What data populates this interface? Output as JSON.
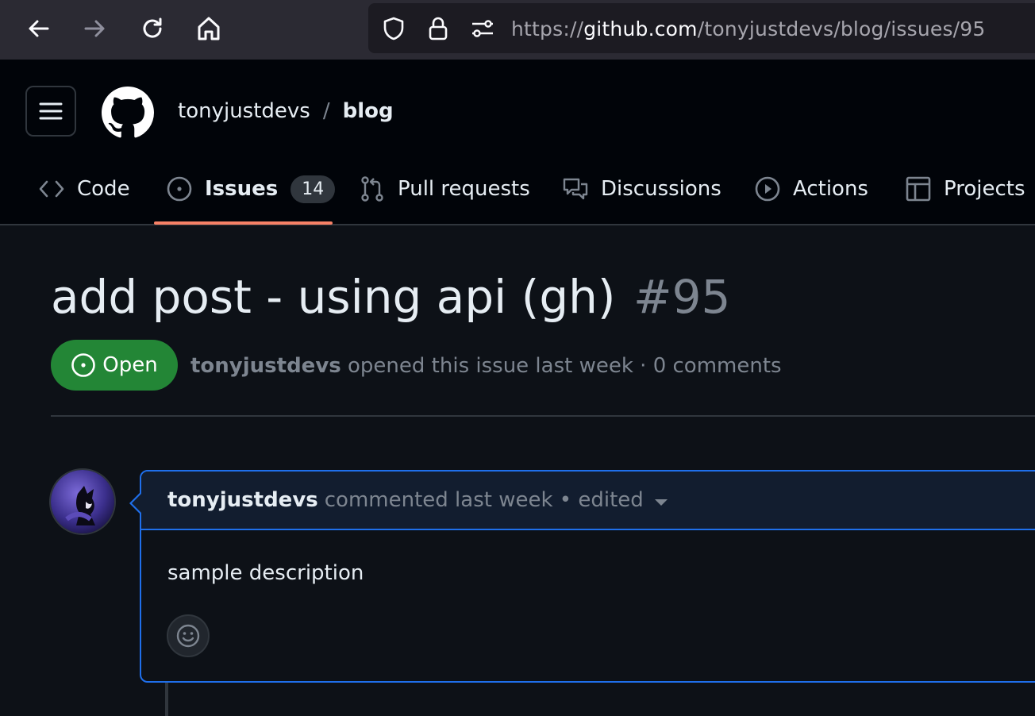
{
  "browser": {
    "url_prefix": "https://",
    "url_host": "github.com",
    "url_path": "/tonyjustdevs/blog/issues/95"
  },
  "repo": {
    "owner": "tonyjustdevs",
    "separator": "/",
    "name": "blog"
  },
  "tabs": [
    {
      "label": "Code",
      "icon": "code-icon"
    },
    {
      "label": "Issues",
      "icon": "issue-opened-icon",
      "count": "14",
      "active": true
    },
    {
      "label": "Pull requests",
      "icon": "git-pull-request-icon"
    },
    {
      "label": "Discussions",
      "icon": "comment-discussion-icon"
    },
    {
      "label": "Actions",
      "icon": "play-icon"
    },
    {
      "label": "Projects",
      "icon": "table-icon"
    }
  ],
  "issue": {
    "title": "add post - using api (gh)",
    "number": "#95",
    "state": "Open",
    "author": "tonyjustdevs",
    "meta_text": "opened this issue last week · 0 comments"
  },
  "comment": {
    "author": "tonyjustdevs",
    "meta_text": "commented last week • edited",
    "body": "sample description"
  },
  "colors": {
    "accent_underline": "#f78166",
    "open_badge": "#238636",
    "comment_border": "#1f6feb"
  }
}
